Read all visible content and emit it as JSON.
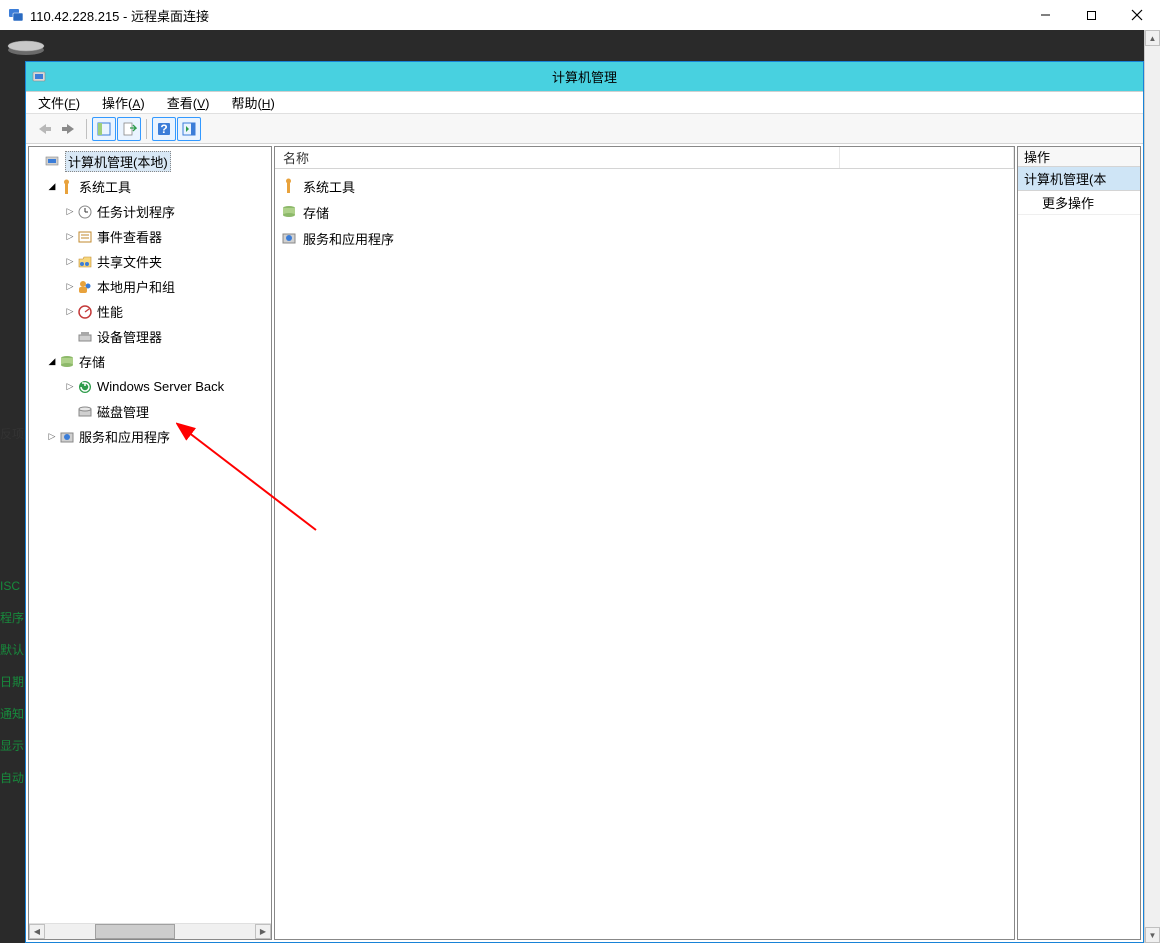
{
  "rdp": {
    "title": "110.42.228.215 - 远程桌面连接"
  },
  "cm": {
    "title": "计算机管理",
    "menu": {
      "file": "文件(F)",
      "action": "操作(A)",
      "view": "查看(V)",
      "help": "帮助(H)"
    }
  },
  "tree": {
    "root": "计算机管理(本地)",
    "system_tools": "系统工具",
    "task_scheduler": "任务计划程序",
    "event_viewer": "事件查看器",
    "shared_folders": "共享文件夹",
    "local_users": "本地用户和组",
    "performance": "性能",
    "device_manager": "设备管理器",
    "storage": "存储",
    "wsb": "Windows Server Back",
    "disk_mgmt": "磁盘管理",
    "services_apps": "服务和应用程序"
  },
  "list": {
    "header_name": "名称",
    "items": {
      "system_tools": "系统工具",
      "storage": "存储",
      "services_apps": "服务和应用程序"
    }
  },
  "actions": {
    "header": "操作",
    "section": "计算机管理(本",
    "more": "更多操作"
  },
  "peek": {
    "r0": "反项",
    "r1": "ISC",
    "r2": "程序",
    "r3": "默认",
    "r4": "日期",
    "r5": "通知",
    "r6": "显示",
    "r7": "自动"
  }
}
